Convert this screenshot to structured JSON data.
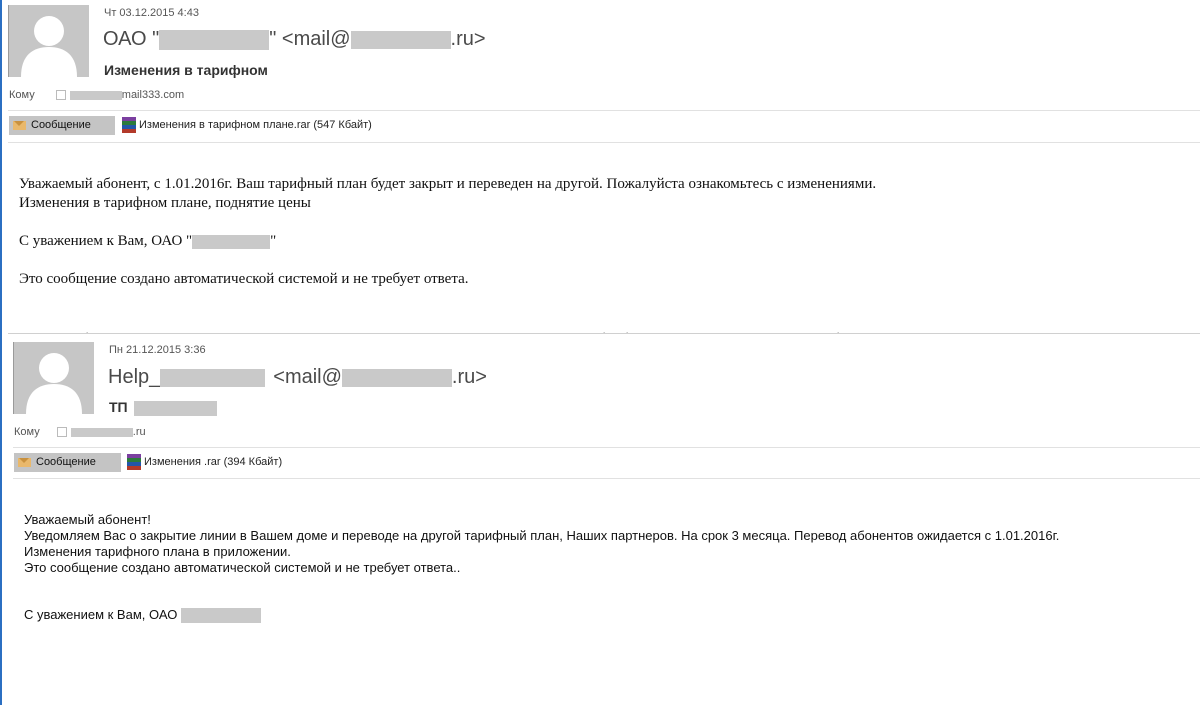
{
  "email1": {
    "date": "Чт 03.12.2015 4:43",
    "from_prefix": "ОАО \"",
    "from_mid": "\" <mail@",
    "from_suffix": ".ru>",
    "subject": "Изменения в тарифном",
    "to_label": "Кому",
    "to_suffix": "mail333.com",
    "message_tab": "Сообщение",
    "attachment": "Изменения в тарифном плане.rar (547 Кбайт)",
    "body_line1": "Уважаемый абонент, с 1.01.2016г. Ваш тарифный план будет закрыт и переведен на другой. Пожалуйста ознакомьтесь с изменениями.",
    "body_line2": "Изменения в тарифном плане, поднятие цены",
    "sign_prefix": "С уважением к Вам, ОАО \"",
    "sign_suffix": "\"",
    "auto_note": "Это сообщение создано автоматической системой и не требует ответа."
  },
  "email2": {
    "date": "Пн 21.12.2015 3:36",
    "from_prefix": "Help_",
    "from_mid": "<mail@",
    "from_suffix": ".ru>",
    "subject": "ТП",
    "to_label": "Кому",
    "to_suffix": ".ru",
    "message_tab": "Сообщение",
    "attachment": "Изменения .rar (394 Кбайт)",
    "body_line1": "Уважаемый абонент!",
    "body_line2": "Уведомляем Вас о закрытие линии в Вашем доме и переводе на другой тарифный план, Наших партнеров. На срок 3 месяца. Перевод абонентов ожидается с 1.01.2016г.",
    "body_line3": "Изменения тарифного плана в приложении.",
    "body_line4": "Это сообщение создано автоматической системой и не требует ответа..",
    "sign": "С уважением к Вам, ОАО"
  },
  "icons": {
    "avatar": "person-silhouette",
    "message": "envelope-icon",
    "attachment": "winrar-archive-icon"
  },
  "colors": {
    "accent": "#2b6fc2",
    "redaction": "#c9c9c9",
    "tab": "#c4c4c4"
  }
}
